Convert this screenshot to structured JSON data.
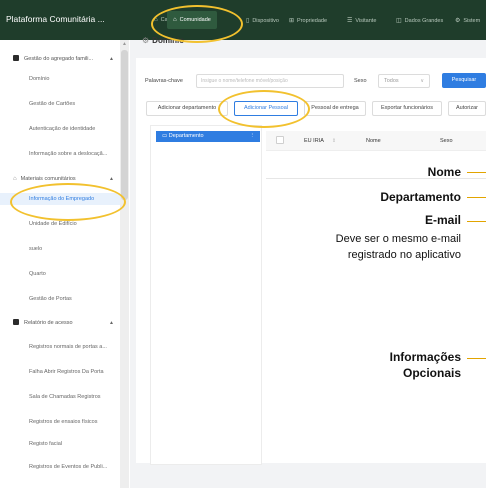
{
  "app": {
    "title": "Plataforma Comunitária ..."
  },
  "nav": {
    "items": [
      {
        "label": "Casa",
        "icon": "home-icon"
      },
      {
        "label": "Comunidade",
        "icon": "home-icon"
      },
      {
        "label": "Dispositivo",
        "icon": "device-icon"
      },
      {
        "label": "Propriedade",
        "icon": "property-icon"
      },
      {
        "label": "Visitante",
        "icon": "visitor-icon"
      },
      {
        "label": "Dados Grandes",
        "icon": "chart-icon"
      },
      {
        "label": "Sistem",
        "icon": "gear-icon"
      }
    ],
    "active_index": 1
  },
  "sidebar": {
    "groups": [
      {
        "label": "Gestão do agregado famili...",
        "items": [
          "Domínio",
          "Gestão de Cartões",
          "Autenticação de identidade",
          "Informação sobre a deslocaçã..."
        ]
      },
      {
        "label": "Materiais comunitários",
        "items": [
          "Informação do Empregado",
          "Unidade de Edifício",
          "suelo",
          "Quarto",
          "Gestão de Portas"
        ]
      },
      {
        "label": "Relatório de acesso",
        "items": [
          "Registros normais de portas a...",
          "Falha Abrir Registros Da Porta",
          "Sala de Chamadas Registros",
          "Registros de ensaios físicos",
          "Registo facial",
          "Registros de Eventos de Publi..."
        ]
      }
    ],
    "active_item": "Informação do Empregado"
  },
  "breadcrumb": {
    "title": "Domínio"
  },
  "search": {
    "keyword_label": "Palavras-chave",
    "keyword_placeholder": "Insigue o nome/telefone móvel/posição",
    "sex_label": "Sexo",
    "sex_value": "Todos",
    "search_button": "Pesquisar"
  },
  "toolbar": {
    "add_department": "Adicionar departamento",
    "add_person": "Adicionar Pessoal",
    "delivery_staff": "Pessoal de entrega",
    "export_staff": "Exportar funcionários",
    "authorize": "Autorizar"
  },
  "tree": {
    "root": "Departamento",
    "more": "⋮"
  },
  "table": {
    "columns": [
      "EU IRIA",
      "Nome",
      "Sexo"
    ]
  },
  "annotations": {
    "name": "Nome",
    "department": "Departamento",
    "email": "E-mail",
    "email_note_1": "Deve ser o mesmo e-mail",
    "email_note_2": "registrado no aplicativo",
    "optional_1": "Informações",
    "optional_2": "Opcionais"
  },
  "colors": {
    "topbar": "#1f3d2b",
    "accent": "#2f7de1",
    "annotation": "#e2a400",
    "highlight": "#f2c12e"
  }
}
